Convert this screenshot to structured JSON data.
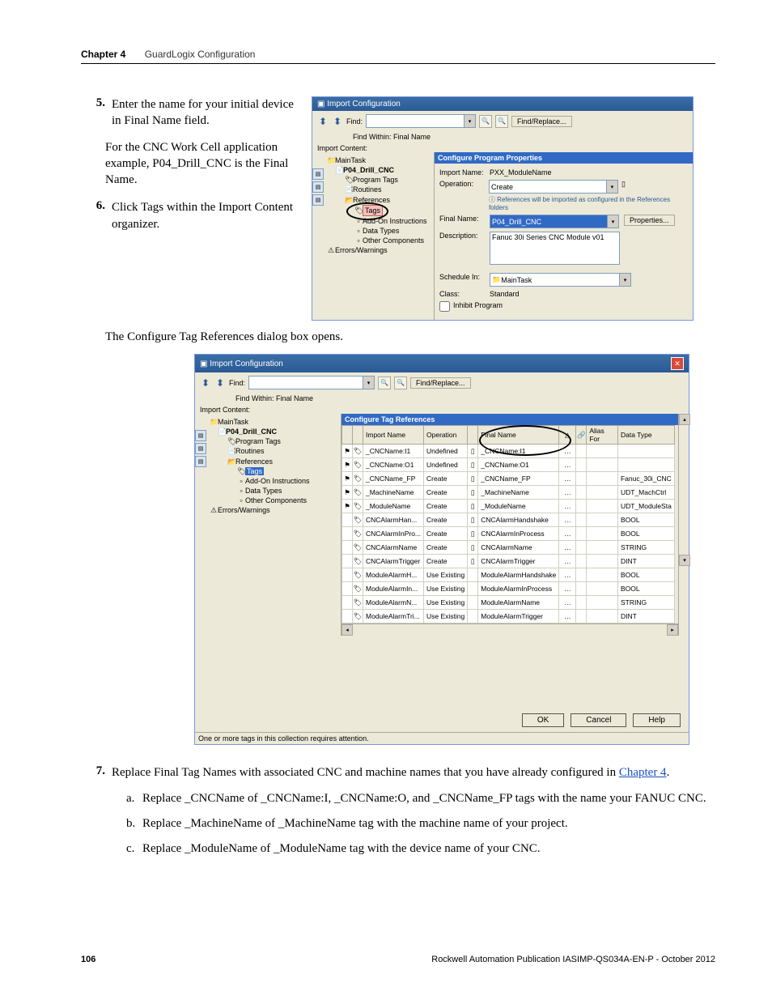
{
  "header": {
    "chapter": "Chapter 4",
    "title": "GuardLogix Configuration"
  },
  "steps": {
    "s5": {
      "num": "5.",
      "text": "Enter the name for your initial device in Final Name field.",
      "para": "For the CNC Work Cell application example, P04_Drill_CNC is the Final Name."
    },
    "s6": {
      "num": "6.",
      "text": "Click Tags within the Import Content organizer."
    },
    "result": "The Configure Tag References dialog box opens.",
    "s7": {
      "num": "7.",
      "text_a": "Replace Final Tag Names with associated CNC and machine names that you have already configured in ",
      "link": "Chapter 4",
      "text_b": ".",
      "a": "Replace _CNCName of _CNCName:I, _CNCName:O, and _CNCName_FP tags with the name your FANUC CNC.",
      "b": "Replace _MachineName of _MachineName tag with the machine name of your project.",
      "c": "Replace _ModuleName of _ModuleName tag with the device name of your CNC."
    }
  },
  "dlg1": {
    "title": "Import Configuration",
    "find": "Find:",
    "find_within": "Find Within: Final Name",
    "find_replace": "Find/Replace...",
    "import_content": "Import Content:",
    "tree": {
      "main": "MainTask",
      "prog": "P04_Drill_CNC",
      "ptags": "Program Tags",
      "routines": "Routines",
      "refs": "References",
      "tags": "Tags",
      "aoi": "Add-On Instructions",
      "dtypes": "Data Types",
      "other": "Other Components",
      "errs": "Errors/Warnings"
    },
    "right": {
      "head": "Configure Program Properties",
      "import_name_l": "Import Name:",
      "import_name_v": "PXX_ModuleName",
      "operation_l": "Operation:",
      "operation_v": "Create",
      "info": "References will be imported as configured in the References folders",
      "final_name_l": "Final Name:",
      "final_name_v": "P04_Drill_CNC",
      "properties": "Properties...",
      "desc_l": "Description:",
      "desc_v": "Fanuc 30i Series CNC Module v01",
      "sched_l": "Schedule In:",
      "sched_v": "MainTask",
      "class_l": "Class:",
      "class_v": "Standard",
      "inhibit": "Inhibit Program"
    }
  },
  "dlg2": {
    "title": "Import Configuration",
    "find": "Find:",
    "find_within": "Find Within: Final Name",
    "find_replace": "Find/Replace...",
    "import_content": "Import Content:",
    "tree": {
      "main": "MainTask",
      "prog": "P04_Drill_CNC",
      "ptags": "Program Tags",
      "routines": "Routines",
      "refs": "References",
      "tags": "Tags",
      "aoi": "Add-On Instructions",
      "dtypes": "Data Types",
      "other": "Other Components",
      "errs": "Errors/Warnings"
    },
    "sect": "Configure Tag References",
    "cols": {
      "imp": "Import Name",
      "op": "Operation",
      "fn": "Final Name",
      "alias": "Alias For",
      "dt": "Data Type"
    },
    "rows": [
      {
        "i": "_CNCName:I1",
        "o": "Undefined",
        "f": "_CNCName:I1",
        "d": ""
      },
      {
        "i": "_CNCName:O1",
        "o": "Undefined",
        "f": "_CNCName:O1",
        "d": ""
      },
      {
        "i": "_CNCName_FP",
        "o": "Create",
        "f": "_CNCName_FP",
        "d": "Fanuc_30i_CNC"
      },
      {
        "i": "_MachineName",
        "o": "Create",
        "f": "_MachineName",
        "d": "UDT_MachCtrl"
      },
      {
        "i": "_ModuleName",
        "o": "Create",
        "f": "_ModuleName",
        "d": "UDT_ModuleSta"
      },
      {
        "i": "CNCAlarmHan...",
        "o": "Create",
        "f": "CNCAlarmHandshake",
        "d": "BOOL"
      },
      {
        "i": "CNCAlarmInPro...",
        "o": "Create",
        "f": "CNCAlarmInProcess",
        "d": "BOOL"
      },
      {
        "i": "CNCAlarmName",
        "o": "Create",
        "f": "CNCAlarmName",
        "d": "STRING"
      },
      {
        "i": "CNCAlarmTrigger",
        "o": "Create",
        "f": "CNCAlarmTrigger",
        "d": "DINT"
      },
      {
        "i": "ModuleAlarmH...",
        "o": "Use Existing",
        "f": "ModuleAlarmHandshake",
        "d": "BOOL"
      },
      {
        "i": "ModuleAlarmIn...",
        "o": "Use Existing",
        "f": "ModuleAlarmInProcess",
        "d": "BOOL"
      },
      {
        "i": "ModuleAlarmN...",
        "o": "Use Existing",
        "f": "ModuleAlarmName",
        "d": "STRING"
      },
      {
        "i": "ModuleAlarmTri...",
        "o": "Use Existing",
        "f": "ModuleAlarmTrigger",
        "d": "DINT"
      }
    ],
    "ok": "OK",
    "cancel": "Cancel",
    "help": "Help",
    "status": "One or more tags in this collection requires attention."
  },
  "footer": {
    "page": "106",
    "pub": "Rockwell Automation Publication IASIMP-QS034A-EN-P - October 2012"
  }
}
